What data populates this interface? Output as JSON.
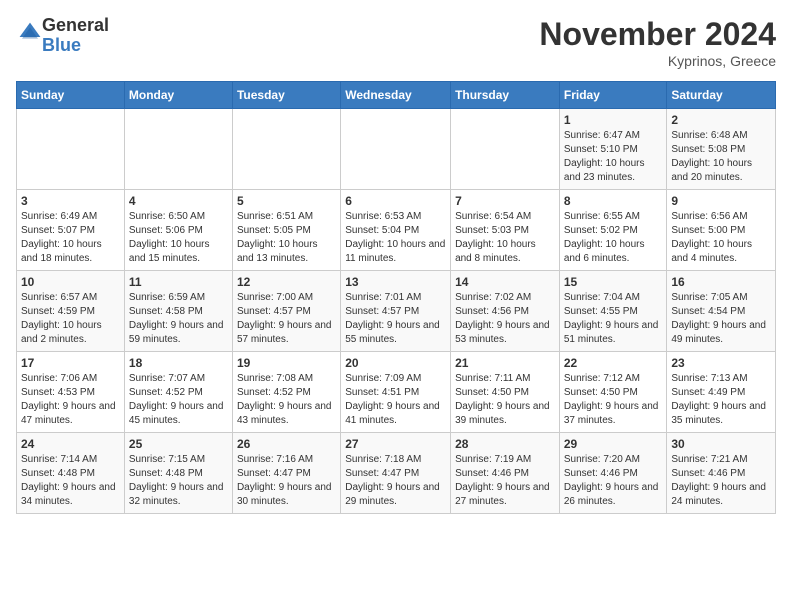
{
  "logo": {
    "general": "General",
    "blue": "Blue"
  },
  "title": "November 2024",
  "subtitle": "Kyprinos, Greece",
  "days_of_week": [
    "Sunday",
    "Monday",
    "Tuesday",
    "Wednesday",
    "Thursday",
    "Friday",
    "Saturday"
  ],
  "weeks": [
    [
      {
        "day": "",
        "info": ""
      },
      {
        "day": "",
        "info": ""
      },
      {
        "day": "",
        "info": ""
      },
      {
        "day": "",
        "info": ""
      },
      {
        "day": "",
        "info": ""
      },
      {
        "day": "1",
        "info": "Sunrise: 6:47 AM\nSunset: 5:10 PM\nDaylight: 10 hours and 23 minutes."
      },
      {
        "day": "2",
        "info": "Sunrise: 6:48 AM\nSunset: 5:08 PM\nDaylight: 10 hours and 20 minutes."
      }
    ],
    [
      {
        "day": "3",
        "info": "Sunrise: 6:49 AM\nSunset: 5:07 PM\nDaylight: 10 hours and 18 minutes."
      },
      {
        "day": "4",
        "info": "Sunrise: 6:50 AM\nSunset: 5:06 PM\nDaylight: 10 hours and 15 minutes."
      },
      {
        "day": "5",
        "info": "Sunrise: 6:51 AM\nSunset: 5:05 PM\nDaylight: 10 hours and 13 minutes."
      },
      {
        "day": "6",
        "info": "Sunrise: 6:53 AM\nSunset: 5:04 PM\nDaylight: 10 hours and 11 minutes."
      },
      {
        "day": "7",
        "info": "Sunrise: 6:54 AM\nSunset: 5:03 PM\nDaylight: 10 hours and 8 minutes."
      },
      {
        "day": "8",
        "info": "Sunrise: 6:55 AM\nSunset: 5:02 PM\nDaylight: 10 hours and 6 minutes."
      },
      {
        "day": "9",
        "info": "Sunrise: 6:56 AM\nSunset: 5:00 PM\nDaylight: 10 hours and 4 minutes."
      }
    ],
    [
      {
        "day": "10",
        "info": "Sunrise: 6:57 AM\nSunset: 4:59 PM\nDaylight: 10 hours and 2 minutes."
      },
      {
        "day": "11",
        "info": "Sunrise: 6:59 AM\nSunset: 4:58 PM\nDaylight: 9 hours and 59 minutes."
      },
      {
        "day": "12",
        "info": "Sunrise: 7:00 AM\nSunset: 4:57 PM\nDaylight: 9 hours and 57 minutes."
      },
      {
        "day": "13",
        "info": "Sunrise: 7:01 AM\nSunset: 4:57 PM\nDaylight: 9 hours and 55 minutes."
      },
      {
        "day": "14",
        "info": "Sunrise: 7:02 AM\nSunset: 4:56 PM\nDaylight: 9 hours and 53 minutes."
      },
      {
        "day": "15",
        "info": "Sunrise: 7:04 AM\nSunset: 4:55 PM\nDaylight: 9 hours and 51 minutes."
      },
      {
        "day": "16",
        "info": "Sunrise: 7:05 AM\nSunset: 4:54 PM\nDaylight: 9 hours and 49 minutes."
      }
    ],
    [
      {
        "day": "17",
        "info": "Sunrise: 7:06 AM\nSunset: 4:53 PM\nDaylight: 9 hours and 47 minutes."
      },
      {
        "day": "18",
        "info": "Sunrise: 7:07 AM\nSunset: 4:52 PM\nDaylight: 9 hours and 45 minutes."
      },
      {
        "day": "19",
        "info": "Sunrise: 7:08 AM\nSunset: 4:52 PM\nDaylight: 9 hours and 43 minutes."
      },
      {
        "day": "20",
        "info": "Sunrise: 7:09 AM\nSunset: 4:51 PM\nDaylight: 9 hours and 41 minutes."
      },
      {
        "day": "21",
        "info": "Sunrise: 7:11 AM\nSunset: 4:50 PM\nDaylight: 9 hours and 39 minutes."
      },
      {
        "day": "22",
        "info": "Sunrise: 7:12 AM\nSunset: 4:50 PM\nDaylight: 9 hours and 37 minutes."
      },
      {
        "day": "23",
        "info": "Sunrise: 7:13 AM\nSunset: 4:49 PM\nDaylight: 9 hours and 35 minutes."
      }
    ],
    [
      {
        "day": "24",
        "info": "Sunrise: 7:14 AM\nSunset: 4:48 PM\nDaylight: 9 hours and 34 minutes."
      },
      {
        "day": "25",
        "info": "Sunrise: 7:15 AM\nSunset: 4:48 PM\nDaylight: 9 hours and 32 minutes."
      },
      {
        "day": "26",
        "info": "Sunrise: 7:16 AM\nSunset: 4:47 PM\nDaylight: 9 hours and 30 minutes."
      },
      {
        "day": "27",
        "info": "Sunrise: 7:18 AM\nSunset: 4:47 PM\nDaylight: 9 hours and 29 minutes."
      },
      {
        "day": "28",
        "info": "Sunrise: 7:19 AM\nSunset: 4:46 PM\nDaylight: 9 hours and 27 minutes."
      },
      {
        "day": "29",
        "info": "Sunrise: 7:20 AM\nSunset: 4:46 PM\nDaylight: 9 hours and 26 minutes."
      },
      {
        "day": "30",
        "info": "Sunrise: 7:21 AM\nSunset: 4:46 PM\nDaylight: 9 hours and 24 minutes."
      }
    ]
  ]
}
